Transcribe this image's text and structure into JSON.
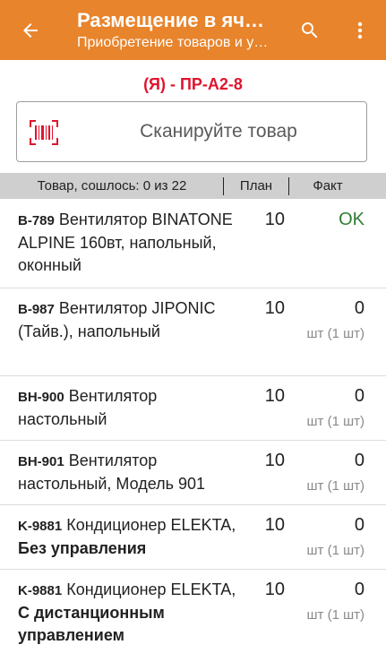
{
  "appbar": {
    "title": "Размещение в яч…",
    "subtitle": "Приобретение товаров и у…"
  },
  "cell": {
    "label": "(Я) - ПР-А2-8"
  },
  "scan": {
    "placeholder": "Сканируйте товар"
  },
  "table": {
    "headers": {
      "name": "Товар, сошлось: 0 из 22",
      "plan": "План",
      "fact": "Факт"
    },
    "rows": [
      {
        "code": "B-789",
        "name": "Вентилятор BINATONE ALPINE 160вт, напольный, оконный",
        "name_bold": "",
        "plan": "10",
        "fact": "OK",
        "unit": ""
      },
      {
        "code": "B-987",
        "name": "Вентилятор JIPONIC (Тайв.), напольный",
        "name_bold": "",
        "plan": "10",
        "fact": "0",
        "unit": "шт (1 шт)"
      },
      {
        "code": "BH-900",
        "name": "Вентилятор настольный",
        "name_bold": "",
        "plan": "10",
        "fact": "0",
        "unit": "шт (1 шт)"
      },
      {
        "code": "BH-901",
        "name": "Вентилятор настольный, Модель 901",
        "name_bold": "",
        "plan": "10",
        "fact": "0",
        "unit": "шт (1 шт)"
      },
      {
        "code": "K-9881",
        "name": "Кондиционер ELEKTA,",
        "name_bold": "Без управления",
        "plan": "10",
        "fact": "0",
        "unit": "шт (1 шт)"
      },
      {
        "code": "K-9881",
        "name": "Кондиционер ELEKTA,",
        "name_bold": "С дистанционным управлением",
        "plan": "10",
        "fact": "0",
        "unit": "шт (1 шт)"
      }
    ]
  },
  "colors": {
    "appbar": "#e8842c",
    "cell_label": "#e0142e",
    "ok": "#2e7d32",
    "header_bg": "#cfcfcf"
  },
  "icons": [
    "back-arrow-icon",
    "search-icon",
    "more-vert-icon",
    "barcode-icon"
  ]
}
